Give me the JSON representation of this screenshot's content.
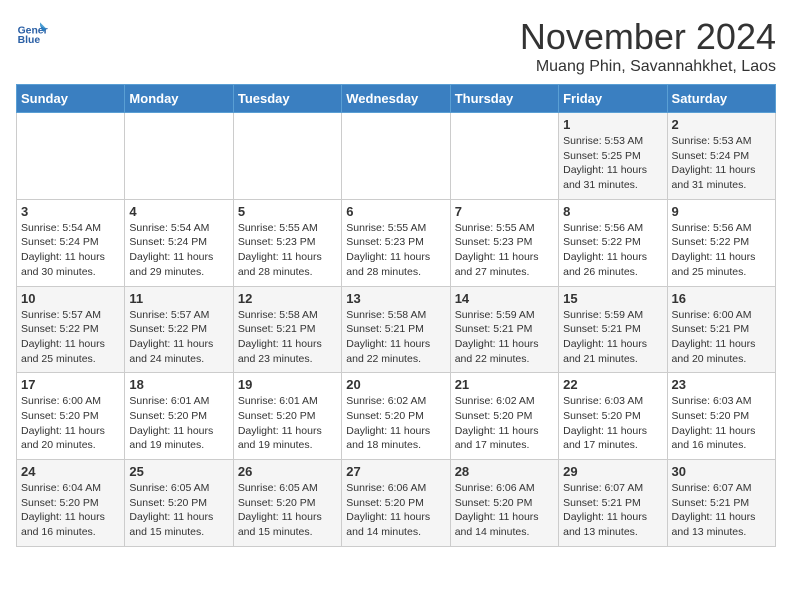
{
  "logo": {
    "line1": "General",
    "line2": "Blue"
  },
  "title": "November 2024",
  "location": "Muang Phin, Savannahkhet, Laos",
  "weekdays": [
    "Sunday",
    "Monday",
    "Tuesday",
    "Wednesday",
    "Thursday",
    "Friday",
    "Saturday"
  ],
  "weeks": [
    [
      {
        "day": "",
        "info": ""
      },
      {
        "day": "",
        "info": ""
      },
      {
        "day": "",
        "info": ""
      },
      {
        "day": "",
        "info": ""
      },
      {
        "day": "",
        "info": ""
      },
      {
        "day": "1",
        "info": "Sunrise: 5:53 AM\nSunset: 5:25 PM\nDaylight: 11 hours\nand 31 minutes."
      },
      {
        "day": "2",
        "info": "Sunrise: 5:53 AM\nSunset: 5:24 PM\nDaylight: 11 hours\nand 31 minutes."
      }
    ],
    [
      {
        "day": "3",
        "info": "Sunrise: 5:54 AM\nSunset: 5:24 PM\nDaylight: 11 hours\nand 30 minutes."
      },
      {
        "day": "4",
        "info": "Sunrise: 5:54 AM\nSunset: 5:24 PM\nDaylight: 11 hours\nand 29 minutes."
      },
      {
        "day": "5",
        "info": "Sunrise: 5:55 AM\nSunset: 5:23 PM\nDaylight: 11 hours\nand 28 minutes."
      },
      {
        "day": "6",
        "info": "Sunrise: 5:55 AM\nSunset: 5:23 PM\nDaylight: 11 hours\nand 28 minutes."
      },
      {
        "day": "7",
        "info": "Sunrise: 5:55 AM\nSunset: 5:23 PM\nDaylight: 11 hours\nand 27 minutes."
      },
      {
        "day": "8",
        "info": "Sunrise: 5:56 AM\nSunset: 5:22 PM\nDaylight: 11 hours\nand 26 minutes."
      },
      {
        "day": "9",
        "info": "Sunrise: 5:56 AM\nSunset: 5:22 PM\nDaylight: 11 hours\nand 25 minutes."
      }
    ],
    [
      {
        "day": "10",
        "info": "Sunrise: 5:57 AM\nSunset: 5:22 PM\nDaylight: 11 hours\nand 25 minutes."
      },
      {
        "day": "11",
        "info": "Sunrise: 5:57 AM\nSunset: 5:22 PM\nDaylight: 11 hours\nand 24 minutes."
      },
      {
        "day": "12",
        "info": "Sunrise: 5:58 AM\nSunset: 5:21 PM\nDaylight: 11 hours\nand 23 minutes."
      },
      {
        "day": "13",
        "info": "Sunrise: 5:58 AM\nSunset: 5:21 PM\nDaylight: 11 hours\nand 22 minutes."
      },
      {
        "day": "14",
        "info": "Sunrise: 5:59 AM\nSunset: 5:21 PM\nDaylight: 11 hours\nand 22 minutes."
      },
      {
        "day": "15",
        "info": "Sunrise: 5:59 AM\nSunset: 5:21 PM\nDaylight: 11 hours\nand 21 minutes."
      },
      {
        "day": "16",
        "info": "Sunrise: 6:00 AM\nSunset: 5:21 PM\nDaylight: 11 hours\nand 20 minutes."
      }
    ],
    [
      {
        "day": "17",
        "info": "Sunrise: 6:00 AM\nSunset: 5:20 PM\nDaylight: 11 hours\nand 20 minutes."
      },
      {
        "day": "18",
        "info": "Sunrise: 6:01 AM\nSunset: 5:20 PM\nDaylight: 11 hours\nand 19 minutes."
      },
      {
        "day": "19",
        "info": "Sunrise: 6:01 AM\nSunset: 5:20 PM\nDaylight: 11 hours\nand 19 minutes."
      },
      {
        "day": "20",
        "info": "Sunrise: 6:02 AM\nSunset: 5:20 PM\nDaylight: 11 hours\nand 18 minutes."
      },
      {
        "day": "21",
        "info": "Sunrise: 6:02 AM\nSunset: 5:20 PM\nDaylight: 11 hours\nand 17 minutes."
      },
      {
        "day": "22",
        "info": "Sunrise: 6:03 AM\nSunset: 5:20 PM\nDaylight: 11 hours\nand 17 minutes."
      },
      {
        "day": "23",
        "info": "Sunrise: 6:03 AM\nSunset: 5:20 PM\nDaylight: 11 hours\nand 16 minutes."
      }
    ],
    [
      {
        "day": "24",
        "info": "Sunrise: 6:04 AM\nSunset: 5:20 PM\nDaylight: 11 hours\nand 16 minutes."
      },
      {
        "day": "25",
        "info": "Sunrise: 6:05 AM\nSunset: 5:20 PM\nDaylight: 11 hours\nand 15 minutes."
      },
      {
        "day": "26",
        "info": "Sunrise: 6:05 AM\nSunset: 5:20 PM\nDaylight: 11 hours\nand 15 minutes."
      },
      {
        "day": "27",
        "info": "Sunrise: 6:06 AM\nSunset: 5:20 PM\nDaylight: 11 hours\nand 14 minutes."
      },
      {
        "day": "28",
        "info": "Sunrise: 6:06 AM\nSunset: 5:20 PM\nDaylight: 11 hours\nand 14 minutes."
      },
      {
        "day": "29",
        "info": "Sunrise: 6:07 AM\nSunset: 5:21 PM\nDaylight: 11 hours\nand 13 minutes."
      },
      {
        "day": "30",
        "info": "Sunrise: 6:07 AM\nSunset: 5:21 PM\nDaylight: 11 hours\nand 13 minutes."
      }
    ]
  ]
}
